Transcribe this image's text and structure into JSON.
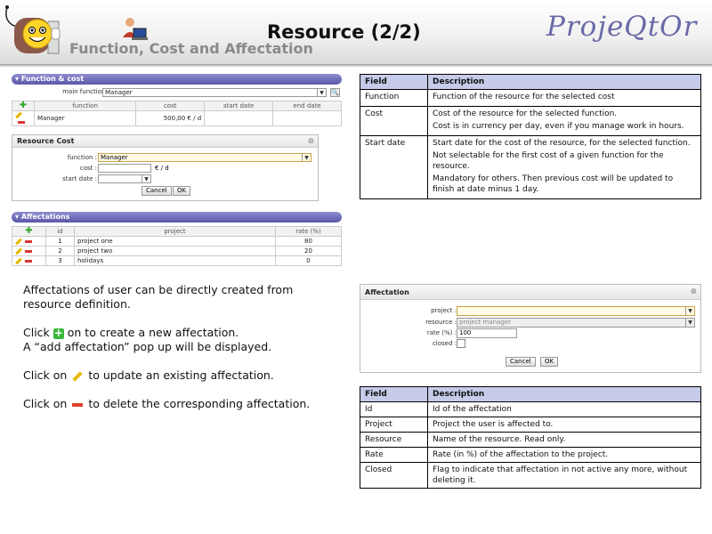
{
  "header": {
    "title": "Resource (2/2)",
    "subtitle": "Function, Cost and Affectation",
    "brand": "ProjeQtOr"
  },
  "function_cost": {
    "panel_title": "Function & cost",
    "main_function_label": "main function :",
    "main_function_value": "Manager",
    "columns": [
      "function",
      "cost",
      "start date",
      "end date"
    ],
    "rows": [
      {
        "function": "Manager",
        "cost": "500,00 € / d",
        "start": "",
        "end": ""
      }
    ]
  },
  "resource_cost_dialog": {
    "title": "Resource Cost",
    "function_label": "function :",
    "function_value": "Manager",
    "cost_label": "cost :",
    "cost_unit": "€ / d",
    "start_label": "start date :",
    "cancel": "Cancel",
    "ok": "OK"
  },
  "affectations": {
    "panel_title": "Affectations",
    "columns": [
      "id",
      "project",
      "rate (%)"
    ],
    "rows": [
      {
        "id": "1",
        "project": "project one",
        "rate": "80"
      },
      {
        "id": "2",
        "project": "project two",
        "rate": "20"
      },
      {
        "id": "3",
        "project": "holidays",
        "rate": "0"
      }
    ]
  },
  "affectation_dialog": {
    "title": "Affectation",
    "project_label": "project :",
    "resource_label": "resource :",
    "resource_value": "project manager",
    "rate_label": "rate (%) :",
    "rate_value": "100",
    "closed_label": "closed :",
    "cancel": "Cancel",
    "ok": "OK"
  },
  "table1": {
    "headers": [
      "Field",
      "Description"
    ],
    "rows": [
      {
        "field": "Function",
        "desc": [
          "Function of the resource for the selected cost"
        ]
      },
      {
        "field": "Cost",
        "desc": [
          "Cost of the resource for the selected function.",
          "Cost is in currency per day, even if you manage work in hours."
        ]
      },
      {
        "field": "Start date",
        "desc": [
          "Start date for the cost of the resource, for the selected function.",
          "Not selectable for the first cost of a given function for the resource.",
          "Mandatory for others. Then previous cost will be updated to finish at date minus 1 day."
        ]
      }
    ]
  },
  "table2": {
    "headers": [
      "Field",
      "Description"
    ],
    "rows": [
      {
        "field": "Id",
        "desc": "Id of the affectation"
      },
      {
        "field": "Project",
        "desc": "Project the user is affected to."
      },
      {
        "field": "Resource",
        "desc": "Name of the resource. Read only."
      },
      {
        "field": "Rate",
        "desc": "Rate (in %) of the affectation to the project."
      },
      {
        "field": "Closed",
        "desc": "Flag to indicate that affectation in not active any more, without deleting it."
      }
    ]
  },
  "text": {
    "p1": "Affectations of user can be directly created from resource definition.",
    "p2a_pre": "Click",
    "p2a_post": "on to create a new affectation.",
    "p2b": "A “add affectation” pop up will be displayed.",
    "p3_pre": "Click on",
    "p3_post": "to update an existing affectation.",
    "p4_pre": "Click on",
    "p4_post": "to delete the corresponding affectation."
  }
}
